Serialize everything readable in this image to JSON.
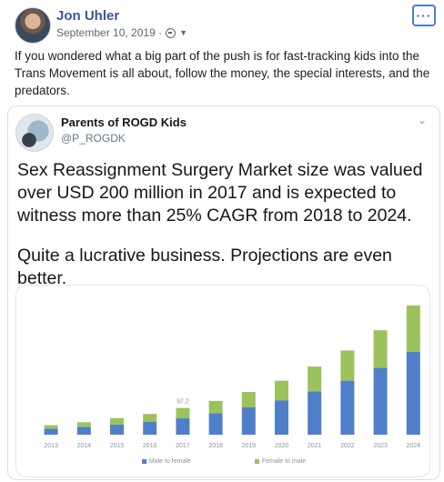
{
  "post": {
    "author": "Jon Uhler",
    "date": "September 10, 2019 ·",
    "privacy_icon": "globe-icon",
    "dropdown_icon": "caret-down-icon",
    "more_label": "···",
    "text": "If you wondered what a big part of the push is for fast-tracking kids into the Trans Movement is all about, follow the money, the special interests, and the predators."
  },
  "tweet": {
    "name": "Parents of ROGD Kids",
    "handle": "@P_ROGDK",
    "chevron": "⌄",
    "text_1": "Sex Reassignment Surgery Market size was valued over USD 200 million in 2017 and is expected to witness more than 25% CAGR from 2018 to 2024.",
    "text_2": "Quite a lucrative business. Projections are even better."
  },
  "colors": {
    "male_to_female": "#4f7fc9",
    "female_to_male": "#9cc25e",
    "facebook_blue": "#385898"
  },
  "chart_data": {
    "type": "bar",
    "stacked": true,
    "categories": [
      "2013",
      "2014",
      "2015",
      "2016",
      "2017",
      "2018",
      "2019",
      "2020",
      "2021",
      "2022",
      "2023",
      "2024"
    ],
    "series": [
      {
        "name": "Male to female",
        "values": [
          10,
          13,
          17,
          22,
          28,
          36,
          46,
          58,
          73,
          91,
          113,
          140
        ]
      },
      {
        "name": "Female to male",
        "values": [
          6,
          8,
          11,
          13,
          17,
          21,
          26,
          33,
          42,
          51,
          63,
          78
        ]
      }
    ],
    "annotations": [
      {
        "category": "2017",
        "text": "97.2"
      }
    ],
    "legend": [
      "Male to female",
      "Female to male"
    ],
    "legend_position": "bottom",
    "ylim": [
      0,
      230
    ],
    "grid": false,
    "y_axis_visible": false
  }
}
